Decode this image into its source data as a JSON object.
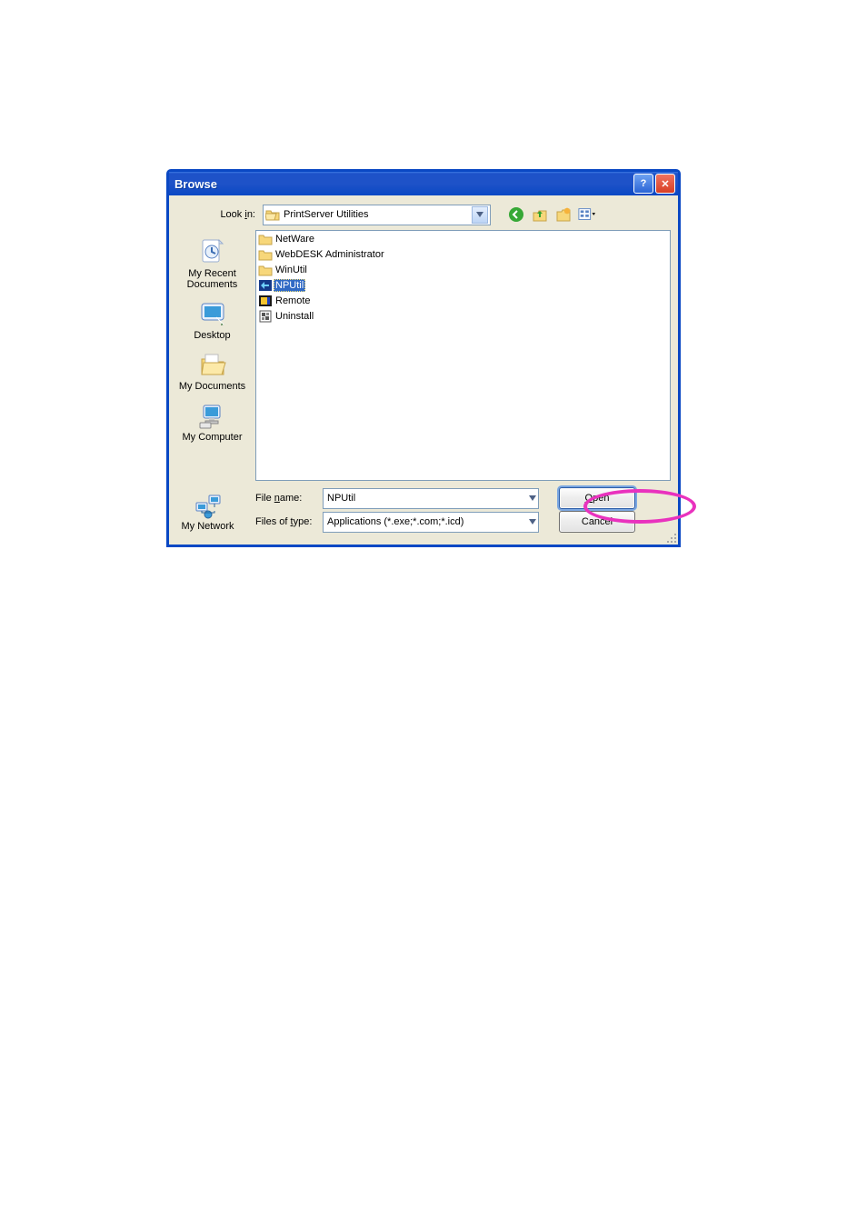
{
  "title": "Browse",
  "lookin_label": "Look in:",
  "lookin_value": "PrintServer Utilities",
  "places": {
    "recent": "My Recent Documents",
    "desktop": "Desktop",
    "mydocs": "My Documents",
    "mycomp": "My Computer",
    "mynet": "My Network"
  },
  "files": [
    {
      "name": "NetWare",
      "type": "folder"
    },
    {
      "name": "WebDESK Administrator",
      "type": "folder"
    },
    {
      "name": "WinUtil",
      "type": "folder"
    },
    {
      "name": "NPUtil",
      "type": "app-blue",
      "selected": true
    },
    {
      "name": "Remote",
      "type": "app-yellow"
    },
    {
      "name": "Uninstall",
      "type": "app-grey"
    }
  ],
  "filename_label": "File name:",
  "filename_value": "NPUtil",
  "filetype_label": "Files of type:",
  "filetype_value": "Applications (*.exe;*.com;*.icd)",
  "open_label": "Open",
  "cancel_label": "Cancel"
}
